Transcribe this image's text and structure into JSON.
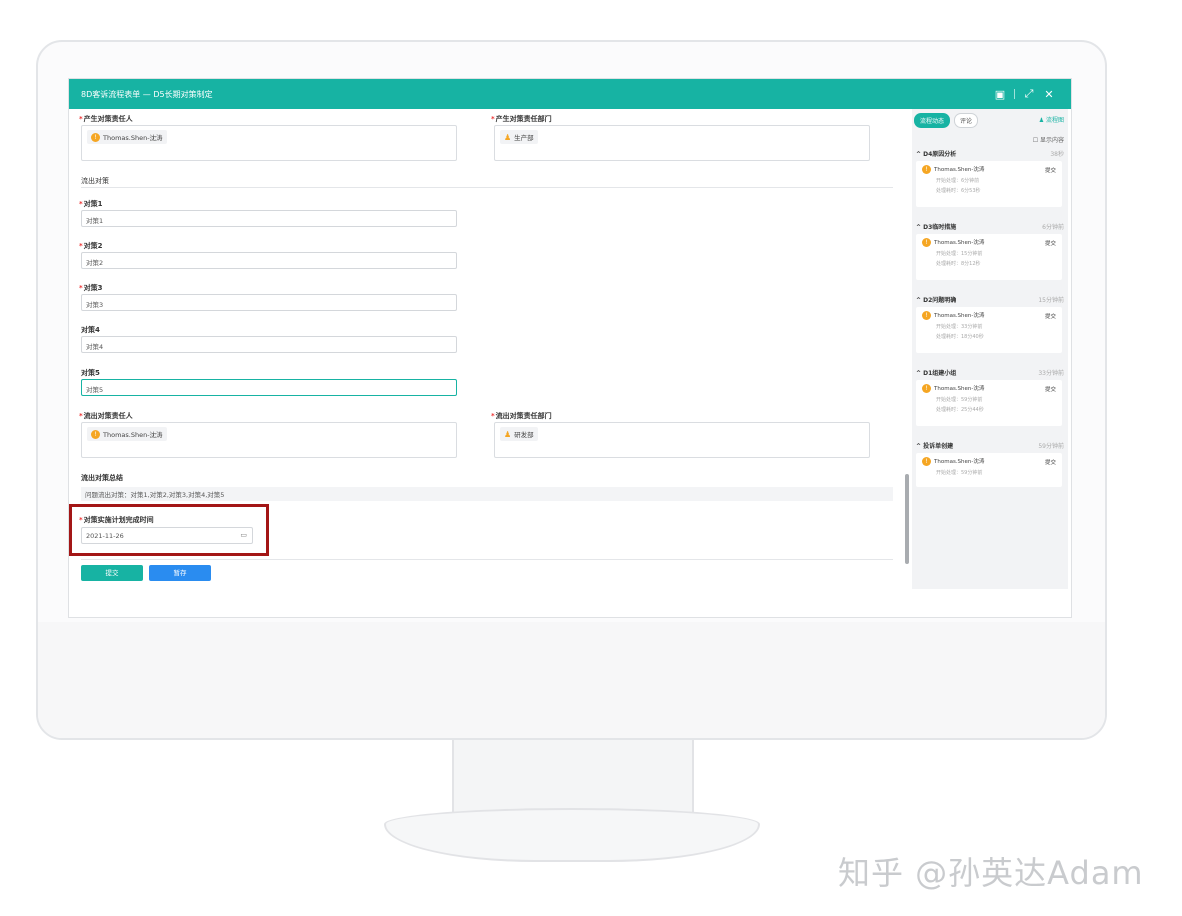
{
  "window": {
    "title": "8D客诉流程表单 — D5长期对策制定"
  },
  "form": {
    "responsible_person_label": "产生对策责任人",
    "responsible_person_value": "Thomas.Shen-沈涛",
    "responsible_dept_label": "产生对策责任部门",
    "responsible_dept_value": "生产部",
    "section_title": "流出对策",
    "measures": [
      {
        "label": "对策1",
        "value": "对策1",
        "required": true
      },
      {
        "label": "对策2",
        "value": "对策2",
        "required": true
      },
      {
        "label": "对策3",
        "value": "对策3",
        "required": true
      },
      {
        "label": "对策4",
        "value": "对策4",
        "required": false
      },
      {
        "label": "对策5",
        "value": "对策5",
        "required": false
      }
    ],
    "outflow_person_label": "流出对策责任人",
    "outflow_person_value": "Thomas.Shen-沈涛",
    "outflow_dept_label": "流出对策责任部门",
    "outflow_dept_value": "研发部",
    "summary_label": "流出对策总结",
    "summary_value": "问题流出对策：对策1,对策2,对策3,对策4,对策5",
    "plan_date_label": "对策实施计划完成时间",
    "plan_date_value": "2021-11-26",
    "submit_label": "提交",
    "save_label": "暂存"
  },
  "panel": {
    "tabs": [
      "流程动态",
      "评论"
    ],
    "link_label": "流程图",
    "show_content_label": "显示内容",
    "steps": [
      {
        "name": "D4原因分析",
        "duration": "38秒",
        "user": "Thomas.Shen-沈涛",
        "action": "提交",
        "start": "开始处理：6分钟前",
        "spent": "处理耗时：6分53秒"
      },
      {
        "name": "D3临时措施",
        "duration": "6分钟前",
        "user": "Thomas.Shen-沈涛",
        "action": "提交",
        "start": "开始处理：15分钟前",
        "spent": "处理耗时：8分12秒"
      },
      {
        "name": "D2问题明确",
        "duration": "15分钟前",
        "user": "Thomas.Shen-沈涛",
        "action": "提交",
        "start": "开始处理：33分钟前",
        "spent": "处理耗时：18分40秒"
      },
      {
        "name": "D1组建小组",
        "duration": "33分钟前",
        "user": "Thomas.Shen-沈涛",
        "action": "提交",
        "start": "开始处理：59分钟前",
        "spent": "处理耗时：25分44秒"
      },
      {
        "name": "投诉单创建",
        "duration": "59分钟前",
        "user": "Thomas.Shen-沈涛",
        "action": "提交",
        "start": "开始处理：59分钟前",
        "spent": ""
      }
    ]
  },
  "watermark": "知乎 @孙英达Adam",
  "colors": {
    "accent": "#17b3a3",
    "primary": "#2a8cf0",
    "highlight": "#a31616"
  }
}
